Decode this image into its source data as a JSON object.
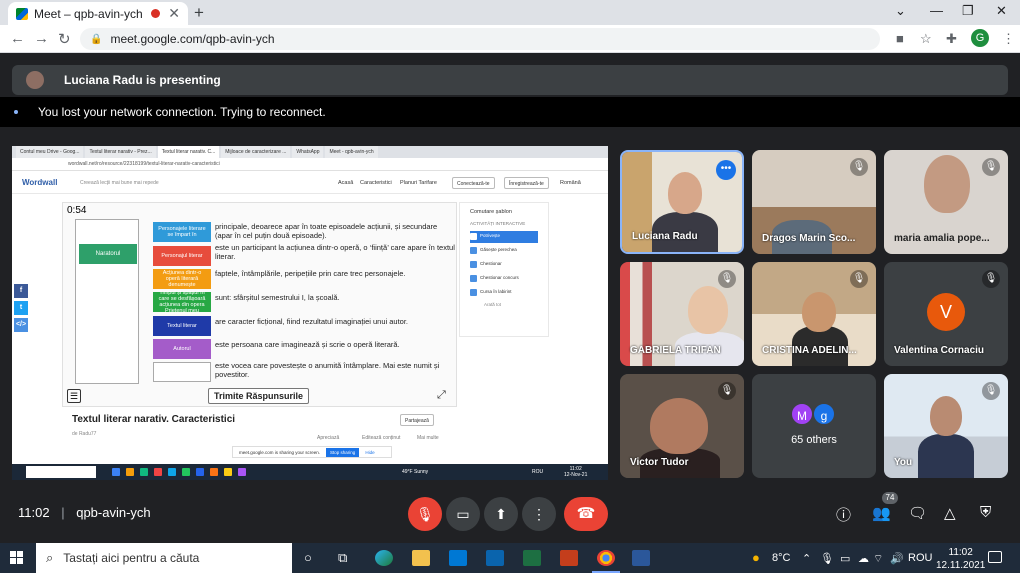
{
  "browser": {
    "tab_title": "Meet – qpb-avin-ych",
    "tab_close": "✕",
    "new_tab": "+",
    "url": "meet.google.com/qpb-avin-ych",
    "profile_initial": "G",
    "window_controls": {
      "minimize": "—",
      "restore": "❐",
      "close": "✕"
    }
  },
  "meet": {
    "presenting_banner": "Luciana Radu is presenting",
    "network_message": "You lost your network connection. Trying to reconnect.",
    "meeting_time": "11:02",
    "meeting_code": "qpb-avin-ych",
    "participant_count": "74"
  },
  "shared_screen": {
    "tabs": [
      "Contul meu Drive - Goog...",
      "Textul literar narativ - Prez...",
      "Textul literar narativ. C...",
      "Mijloace de caracterizare ...",
      "WhatsApp",
      "Meet - qpb-avin-ych"
    ],
    "url": "wordwall.net/ro/resource/22318199/textul-literar-narativ-caracteristici",
    "logo": "Wordwall",
    "tagline": "Creează lecții mai bune mai repede",
    "nav": [
      "Acasă",
      "Caracteristici",
      "Planuri Tarifare"
    ],
    "login": "Conectează-te",
    "signup": "Înregistrează-te",
    "language": "Română",
    "timer": "0:54",
    "slot_answer": "Naratorul",
    "cards": [
      {
        "label": "Personajele literare se împart în",
        "color": "#2f9ad9"
      },
      {
        "label": "Personajul literar",
        "color": "#e74c3c"
      },
      {
        "label": "Acțiunea dintr-o operă literară denumește",
        "color": "#f39c12"
      },
      {
        "label": "Timpul și spațiul în care se desfășoară acțiunea din opera Prietenul meu",
        "color": "#27a844"
      },
      {
        "label": "Textul literar",
        "color": "#1f3aa8"
      },
      {
        "label": "Autorul",
        "color": "#a45cc9"
      },
      {
        "label": "",
        "color": "#ffffff"
      }
    ],
    "statements": [
      "principale, deoarece apar în toate episoadele acțiunii, și secundare (apar în cel puțin două episoade).",
      "este un participant la acțiunea dintr-o operă, o ‘ființă’ care apare în textul literar.",
      "faptele, întâmplările, peripețiile prin care trec personajele.",
      "sunt: sfârșitul semestrului I, la școală.",
      "are caracter ficțional, fiind rezultatul imaginației unui autor.",
      "este persoana care imaginează și scrie o operă literară.",
      "este vocea care povestește o anumită întâmplare. Mai este numit și povestitor."
    ],
    "submit": "Trimite Răspunsurile",
    "side_title": "Comutare șablon",
    "side_heading": "ACTIVITĂȚI INTERACTIVE",
    "side_items": [
      "Potrivește",
      "Găsește perechea",
      "Chestionar",
      "Chestionar concurs",
      "Cursa în labirint"
    ],
    "side_more": "Arată tot",
    "game_title": "Textul literar narativ. Caracteristici",
    "author": "de  Radu77",
    "share": "Partajează",
    "meta": [
      "Apreciază",
      "Editează conținut",
      "Mai multe"
    ],
    "sharing_notice": "meet.google.com is sharing your screen.",
    "stop_sharing": "Stop sharing",
    "hide": "Hide",
    "mini_weather": "49°F  Sunny",
    "mini_lang": "ROU",
    "mini_time": "11:02",
    "mini_date": "12-Nov-21"
  },
  "participants": [
    {
      "name": "Luciana Radu"
    },
    {
      "name": "Dragos Marin Sco..."
    },
    {
      "name": "maria amalia pope..."
    },
    {
      "name": "GABRIELA TRIFAN"
    },
    {
      "name": "CRISTINA ADELIN..."
    },
    {
      "name": "Valentina Cornaciu",
      "initial": "V"
    },
    {
      "name": "Victor Tudor"
    },
    {
      "name": "65 others",
      "initials": [
        "M",
        "g"
      ]
    },
    {
      "name": "You"
    }
  ],
  "taskbar": {
    "search_placeholder": "Tastați aici pentru a căuta",
    "temperature": "8°C",
    "language": "ROU",
    "time": "11:02",
    "date": "12.11.2021"
  },
  "colors": {
    "meet_bg": "#202124",
    "tile_bg": "#3c4043",
    "leave_red": "#ea4335",
    "accent_blue": "#1a73e8"
  }
}
